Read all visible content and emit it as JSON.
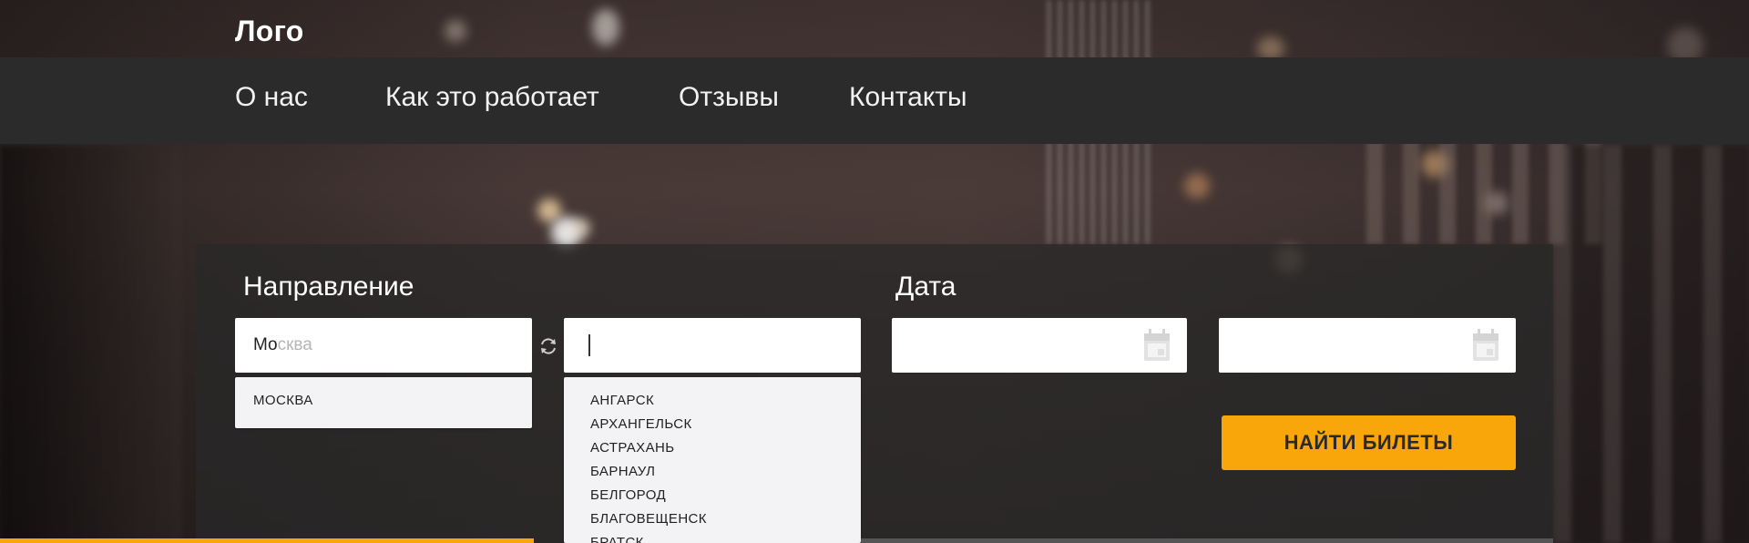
{
  "header": {
    "logo": "Лого"
  },
  "nav": {
    "items": [
      {
        "label": "О нас"
      },
      {
        "label": "Как это работает"
      },
      {
        "label": "Отзывы"
      },
      {
        "label": "Контакты"
      }
    ]
  },
  "search": {
    "direction_title": "Направление",
    "date_title": "Дата",
    "from": {
      "typed": "Мо",
      "hint": "сква"
    },
    "to": {
      "value": ""
    },
    "date_from": {
      "value": ""
    },
    "date_to": {
      "value": ""
    },
    "from_suggestions": [
      "МОСКВА"
    ],
    "to_suggestions": [
      "АНГАРСК",
      "АРХАНГЕЛЬСК",
      "АСТРАХАНЬ",
      "БАРНАУЛ",
      "БЕЛГОРОД",
      "БЛАГОВЕЩЕНСК",
      "БРАТСК"
    ],
    "find_button": "НАЙТИ БИЛЕТЫ"
  },
  "colors": {
    "accent": "#f9a60b",
    "navbar": "#2b2b2b",
    "panel": "rgba(40,40,40,0.72)"
  },
  "icons": {
    "swap": "swap-arrows-icon",
    "calendar": "calendar-icon"
  }
}
